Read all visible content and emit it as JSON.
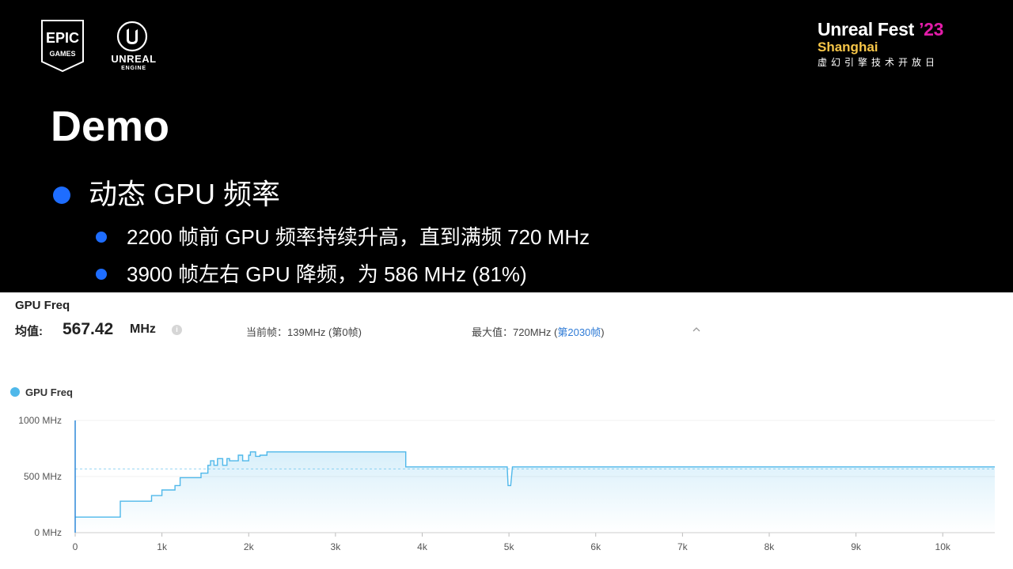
{
  "branding": {
    "epic_top": "EPIC",
    "epic_bottom": "GAMES",
    "unreal_word": "UNREAL",
    "unreal_sub": "ENGINE",
    "fest_name": "Unreal Fest",
    "fest_year": "’23",
    "fest_city": "Shanghai",
    "fest_cn": "虚幻引擎技术开放日",
    "colors": {
      "fest_year": "#e21ca8",
      "fest_city": "#f7c648"
    }
  },
  "slide": {
    "title": "Demo",
    "bullet_color": "#1e6dff",
    "bullet": "动态 GPU 频率",
    "sub_bullets": [
      "2200 帧前 GPU 频率持续升高，直到满频 720 MHz",
      "3900 帧左右 GPU 降频，为 586 MHz (81%)"
    ]
  },
  "panel": {
    "title": "GPU Freq",
    "avg_label": "均值:",
    "avg_value": "567.42",
    "avg_unit": "MHz",
    "info_icon": "info-icon",
    "current_frame": "当前帧：139MHz (第0帧)",
    "max_label": "最大值：720MHz (",
    "max_link": "第2030帧",
    "max_close": ")",
    "collapse_icon": "chevron-up-icon"
  },
  "chart_data": {
    "type": "area",
    "legend": [
      "GPU Freq"
    ],
    "series_color": "#4fb8ea",
    "average_line": 567.42,
    "ylim": [
      0,
      1000
    ],
    "xlim": [
      0,
      10600
    ],
    "y_ticks": [
      0,
      500,
      1000
    ],
    "y_tick_labels": [
      "0 MHz",
      "500 MHz",
      "1000 MHz"
    ],
    "x_ticks": [
      0,
      1000,
      2000,
      3000,
      4000,
      5000,
      6000,
      7000,
      8000,
      9000,
      10000
    ],
    "x_tick_labels": [
      "0",
      "1k",
      "2k",
      "3k",
      "4k",
      "5k",
      "6k",
      "7k",
      "8k",
      "9k",
      "10k"
    ],
    "series": [
      {
        "name": "GPU Freq",
        "x": [
          0,
          520,
          520,
          880,
          880,
          1000,
          1000,
          1150,
          1150,
          1210,
          1210,
          1450,
          1450,
          1530,
          1530,
          1560,
          1560,
          1600,
          1600,
          1640,
          1640,
          1700,
          1700,
          1750,
          1750,
          1780,
          1780,
          1880,
          1880,
          1930,
          1930,
          2000,
          2000,
          2020,
          2020,
          2080,
          2080,
          2130,
          2130,
          2210,
          2210,
          3810,
          3810,
          4980,
          4990,
          5020,
          5040,
          10600
        ],
        "y": [
          139,
          139,
          280,
          280,
          330,
          330,
          380,
          380,
          420,
          420,
          490,
          490,
          530,
          530,
          600,
          600,
          640,
          640,
          600,
          600,
          660,
          660,
          600,
          600,
          660,
          660,
          640,
          640,
          690,
          690,
          640,
          640,
          690,
          690,
          720,
          720,
          680,
          680,
          690,
          690,
          720,
          720,
          586,
          586,
          420,
          420,
          586,
          586
        ]
      }
    ]
  }
}
